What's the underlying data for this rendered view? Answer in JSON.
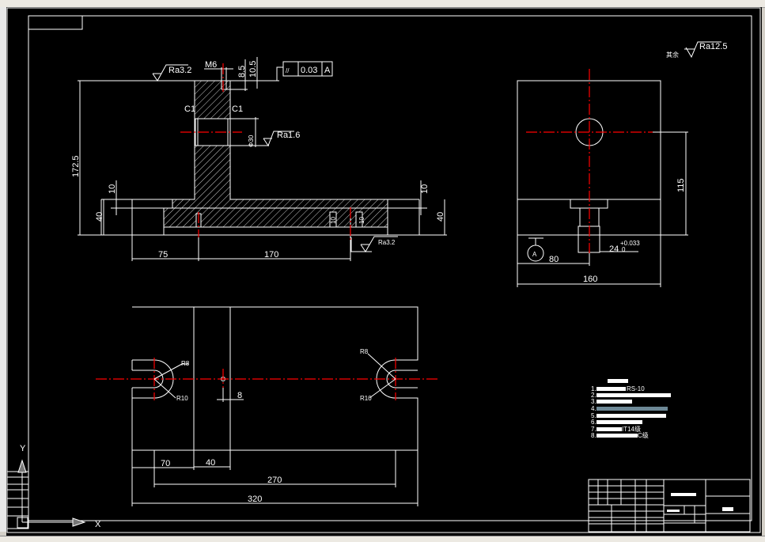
{
  "colors": {
    "background": "#000000",
    "lines": "#ffffff",
    "centerlines": "#ff0000"
  },
  "front_view": {
    "roughness_top": "Ra3.2",
    "thread": "M6",
    "dim_8_5": "8.5",
    "dim_10_5": "10.5",
    "tolerance_symbol": "//",
    "tolerance_value": "0.03",
    "datum": "A",
    "chamfer_left": "C1",
    "chamfer_right": "C1",
    "hole_dia": "Φ30",
    "roughness_hole": "Ra1.6",
    "height": "172.5",
    "step_left": "10",
    "base_left": "40",
    "step_right": "10",
    "base_right": "40",
    "dim_75": "75",
    "dim_170": "170",
    "roughness_bottom": "Ra3.2",
    "slot_dim_a": "10",
    "slot_dim_b": "10"
  },
  "side_view": {
    "other_roughness_label": "其余",
    "other_roughness": "Ra12.5",
    "dim_115": "115",
    "slot_width": "24",
    "slot_tol_upper": "+0.033",
    "slot_tol_lower": "0",
    "datum": "A",
    "dim_80": "80",
    "dim_160": "160"
  },
  "top_view": {
    "r_left_small": "R8",
    "r_left_big": "R10",
    "r_right_small": "R8",
    "r_right_big": "R10",
    "hole_dim": "8",
    "dim_70": "70",
    "dim_40": "40",
    "dim_270": "270",
    "dim_320": "320"
  },
  "notes": {
    "items": [
      "1.",
      "RS-10",
      "2.",
      "3.",
      "4.",
      "5.",
      "6.",
      "7.",
      "IT14级",
      "8.",
      "C级"
    ]
  },
  "ucs": {
    "y_label": "Y",
    "x_label": "X"
  }
}
